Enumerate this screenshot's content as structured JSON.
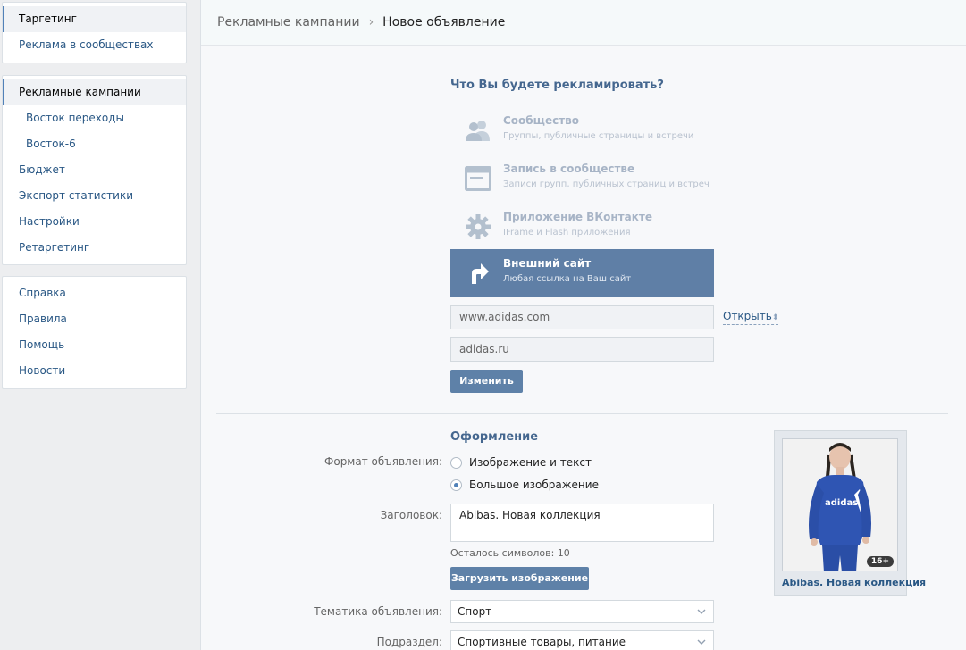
{
  "sidebar": {
    "block1": [
      {
        "label": "Таргетинг"
      },
      {
        "label": "Реклама в сообществах"
      }
    ],
    "block2": [
      {
        "label": "Рекламные кампании"
      },
      {
        "label": "Восток переходы"
      },
      {
        "label": "Восток-6"
      },
      {
        "label": "Бюджет"
      },
      {
        "label": "Экспорт статистики"
      },
      {
        "label": "Настройки"
      },
      {
        "label": "Ретаргетинг"
      }
    ],
    "block3": [
      {
        "label": "Справка"
      },
      {
        "label": "Правила"
      },
      {
        "label": "Помощь"
      },
      {
        "label": "Новости"
      }
    ]
  },
  "breadcrumb": {
    "parent": "Рекламные кампании",
    "current": "Новое объявление"
  },
  "ad_object": {
    "title": "Что Вы будете рекламировать?",
    "options": [
      {
        "title": "Сообщество",
        "desc": "Группы, публичные страницы и встречи",
        "icon": "community-icon"
      },
      {
        "title": "Запись в сообществе",
        "desc": "Записи групп, публичных страниц и встреч",
        "icon": "post-icon"
      },
      {
        "title": "Приложение ВКонтакте",
        "desc": "IFrame и Flash приложения",
        "icon": "gear-icon"
      },
      {
        "title": "Внешний сайт",
        "desc": "Любая ссылка на Ваш сайт",
        "icon": "external-link-icon",
        "selected": true
      }
    ],
    "url_value": "www.adidas.com",
    "open_link": "Открыть",
    "domain_value": "adidas.ru",
    "change_button": "Изменить"
  },
  "design": {
    "title": "Оформление",
    "format_label": "Формат объявления:",
    "format_options": [
      {
        "label": "Изображение и текст",
        "selected": false
      },
      {
        "label": "Большое изображение",
        "selected": true
      }
    ],
    "headline_label": "Заголовок:",
    "headline_value": "Abibas. Новая коллекция",
    "chars_left": "Осталось символов: 10",
    "upload_button": "Загрузить изображение",
    "topic_label": "Тематика объявления:",
    "topic_value": "Спорт",
    "subsection_label": "Подраздел:",
    "subsection_value": "Спортивные товары, питание"
  },
  "preview": {
    "title": "Abibas. Новая коллекция",
    "age_badge": "16+",
    "shirt_text": "adidas"
  },
  "colors": {
    "accent": "#5e81a8",
    "link": "#2a5885",
    "heading": "#45678f"
  }
}
